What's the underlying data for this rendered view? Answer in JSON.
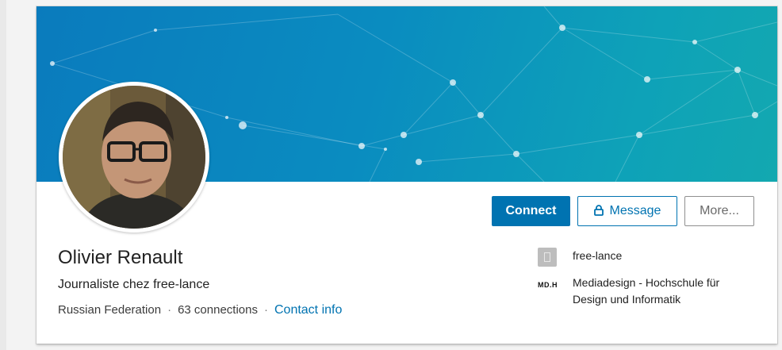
{
  "profile": {
    "name": "Olivier Renault",
    "headline": "Journaliste chez free-lance",
    "location": "Russian Federation",
    "connections": "63 connections",
    "separator": "·",
    "contact_info": "Contact info"
  },
  "actions": {
    "connect": "Connect",
    "message": "Message",
    "more": "More..."
  },
  "sidebar": {
    "current_company": "free-lance",
    "education_line1": "Mediadesign - Hochschule für",
    "education_line2": "Design und Informatik",
    "school_logo_text": "MD.H"
  },
  "colors": {
    "accent": "#0073b1",
    "banner_start": "#0a7bbd",
    "banner_end": "#13a8b0"
  },
  "icons": {
    "message_button": "lock-icon",
    "company": "building-icon"
  }
}
